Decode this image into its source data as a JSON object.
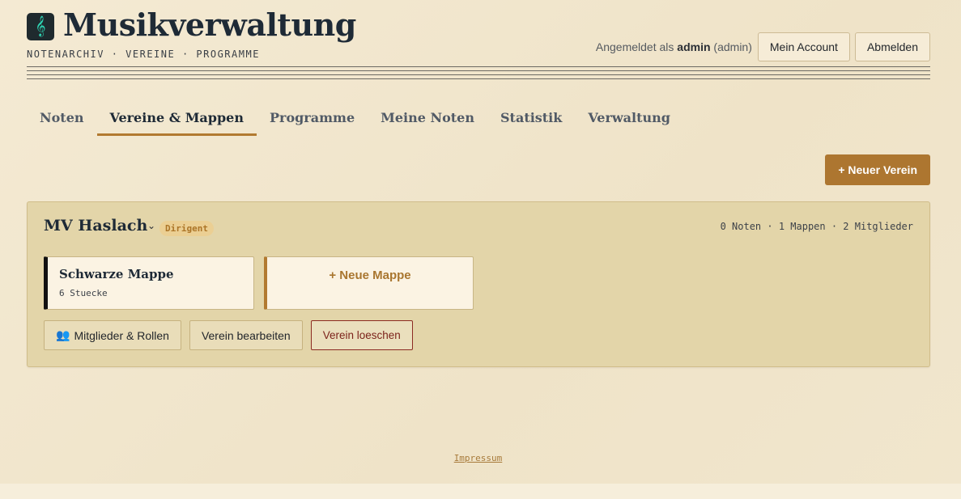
{
  "header": {
    "logo_icon": "treble-clef-icon",
    "title": "Musikverwaltung",
    "subtitle": "NOTENARCHIV · VEREINE · PROGRAMME",
    "user": {
      "label": "Angemeldet als",
      "username": "admin",
      "role": "(admin)",
      "account_button": "Mein Account",
      "logout_button": "Abmelden"
    }
  },
  "tabs": [
    {
      "label": "Noten",
      "active": false
    },
    {
      "label": "Vereine & Mappen",
      "active": true
    },
    {
      "label": "Programme",
      "active": false
    },
    {
      "label": "Meine Noten",
      "active": false
    },
    {
      "label": "Statistik",
      "active": false
    },
    {
      "label": "Verwaltung",
      "active": false
    }
  ],
  "actions": {
    "new_verein": "+ Neuer Verein"
  },
  "verein": {
    "name": "MV Haslach",
    "role_badge": "Dirigent",
    "stats": "0 Noten · 1 Mappen · 2 Mitglieder",
    "mappen": [
      {
        "name": "Schwarze Mappe",
        "count": "6 Stuecke",
        "color": "#111111"
      }
    ],
    "new_mappe": "+ Neue Mappe",
    "buttons": {
      "members_icon": "people-icon",
      "members": "Mitglieder & Rollen",
      "edit": "Verein bearbeiten",
      "delete": "Verein loeschen"
    }
  },
  "footer": {
    "impressum": "Impressum"
  },
  "colors": {
    "accent": "#ad7630",
    "background": "#f1e6cd",
    "card": "#e3d5a9",
    "danger": "#7c231b"
  }
}
